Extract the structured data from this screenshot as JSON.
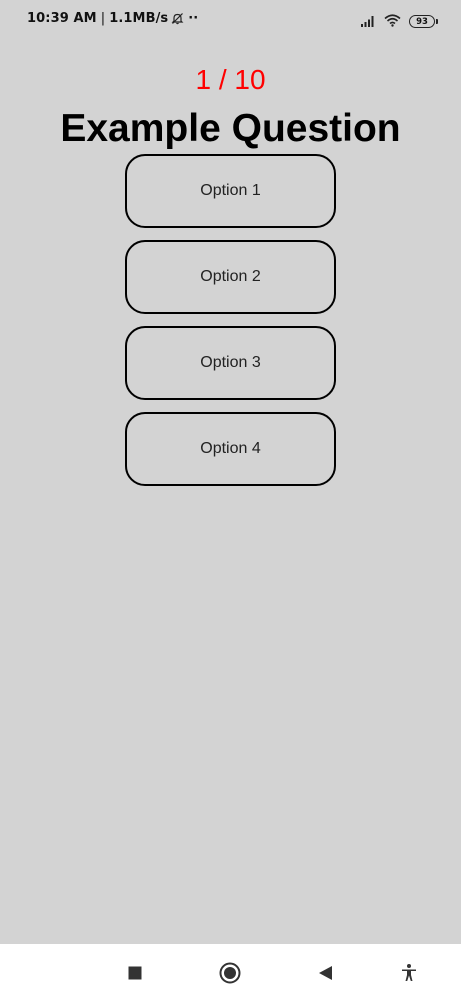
{
  "status_bar": {
    "time": "10:39 AM",
    "separator": "|",
    "net_speed": "1.1MB/s",
    "more": "··",
    "battery_level": "93",
    "icons": [
      "bell-off-icon",
      "signal-icon",
      "wifi-icon",
      "battery-icon"
    ]
  },
  "quiz": {
    "counter": "1 / 10",
    "question": "Example Question",
    "options": [
      "Option 1",
      "Option 2",
      "Option 3",
      "Option 4"
    ]
  },
  "navigation": {
    "buttons": [
      "recents-square-icon",
      "home-circle-icon",
      "back-triangle-icon",
      "accessibility-icon"
    ]
  },
  "colors": {
    "background": "#d3d3d3",
    "counter": "#ff0000",
    "option_border": "#000000",
    "nav_background": "#ffffff"
  }
}
